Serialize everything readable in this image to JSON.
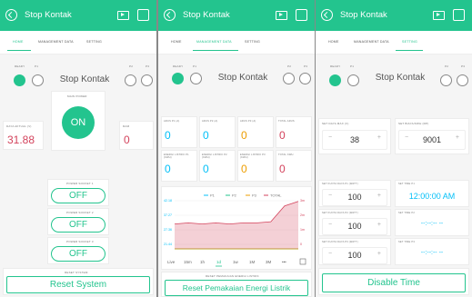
{
  "app_title": "Stop Kontak",
  "tabs": [
    "HOME",
    "MANAGEMENT DATA",
    "SETTING"
  ],
  "colors": {
    "accent": "#23c48e",
    "red": "#d3435c",
    "blue": "#04c0f8",
    "orange": "#ed9d00"
  },
  "icons": [
    "back-icon",
    "play-icon",
    "square-icon"
  ],
  "home": {
    "ready_label": "READY",
    "p1_label": "P1",
    "p2_label": "P2",
    "p3_label": "P3",
    "title_text": "Stop Kontak",
    "main_power_label": "MAIN POWER",
    "main_power_btn": "ON",
    "daya_label": "DAYA AKTUAL (V)",
    "daya_value": "31.88",
    "ampere_label": "RAM",
    "ampere_value": "0",
    "socket1_label": "POWER SOCKET 1",
    "socket1": "OFF",
    "socket2_label": "POWER SOCKET 2",
    "socket2": "OFF",
    "socket3_label": "POWER SOCKET 3",
    "socket3": "OFF",
    "reset_label": "RESET SYSTEM",
    "reset_btn": "Reset System"
  },
  "management": {
    "ready_label": "READY",
    "p1_label": "P1",
    "p2_label": "P2",
    "p3_label": "P3",
    "title_text": "Stop Kontak",
    "cells": [
      {
        "label": "ARUS P1 (A)",
        "value": "0",
        "color": "blue"
      },
      {
        "label": "ARUS P2 (A)",
        "value": "0",
        "color": "blue"
      },
      {
        "label": "ARUS P3 (A)",
        "value": "0",
        "color": "orange"
      },
      {
        "label": "TOTAL ARUS",
        "value": "0",
        "color": "red"
      },
      {
        "label": "ENERGI LISTRIK P1 (KWH)",
        "value": "0",
        "color": "blue"
      },
      {
        "label": "ENERGI LISTRIK P2 (KWH)",
        "value": "0",
        "color": "blue"
      },
      {
        "label": "ENERGI LISTRIK P3 (KWH)",
        "value": "0",
        "color": "orange"
      },
      {
        "label": "TOTAL KWH",
        "value": "0",
        "color": "red"
      }
    ],
    "chart_legend": [
      "P1",
      "P2",
      "P3",
      "TOTAL"
    ],
    "chart_yticks": [
      "42.18",
      "37.27",
      "27.36",
      "21.44"
    ],
    "chart_rticks": [
      "3m",
      "2m",
      "1m",
      "0"
    ],
    "range_tabs": [
      "Live",
      "15m",
      "1h",
      "1d",
      "1w",
      "1M",
      "3M",
      "•••"
    ],
    "reset_label": "RESET PEMAKAIAN ENERGI LISTRIK",
    "reset_btn": "Reset Pemakaian Energi Listrik"
  },
  "setting": {
    "ready_label": "READY",
    "p1_label": "P1",
    "p2_label": "P2",
    "p3_label": "P3",
    "title_text": "Stop Kontak",
    "daya_label": "SET DAYA MAX (V)",
    "daya_value": "38",
    "biaya_label": "SET BIAYA/KWH (RP)",
    "biaya_value": "9001",
    "rows": [
      {
        "label": "SET KUOTA DAYA P1 (WATT)",
        "value": "100",
        "time_label": "SET TIME P1",
        "time": "12:00:00 AM"
      },
      {
        "label": "SET KUOTA DAYA P2 (WATT)",
        "value": "100",
        "time_label": "SET TIME P2",
        "time": "--:--:-- --"
      },
      {
        "label": "SET KUOTA DAYA P3 (WATT)",
        "value": "100",
        "time_label": "SET TIME P3",
        "time": "--:--:-- --"
      }
    ],
    "disable_btn": "Disable Time"
  },
  "chart_data": {
    "type": "line",
    "series": [
      {
        "name": "P1",
        "values": [
          0,
          0,
          0,
          0,
          0,
          0,
          0,
          0,
          0,
          0
        ]
      },
      {
        "name": "P2",
        "values": [
          0,
          0,
          0,
          0,
          0,
          0,
          0,
          0,
          0,
          0
        ]
      },
      {
        "name": "P3",
        "values": [
          0,
          0,
          0,
          0,
          0,
          0,
          0,
          0,
          0,
          0
        ]
      },
      {
        "name": "TOTAL",
        "values": [
          22,
          23,
          22,
          23,
          22,
          23,
          23,
          24,
          38,
          42
        ]
      }
    ],
    "yticks": [
      "42.18",
      "37.27",
      "27.36",
      "21.44"
    ]
  }
}
